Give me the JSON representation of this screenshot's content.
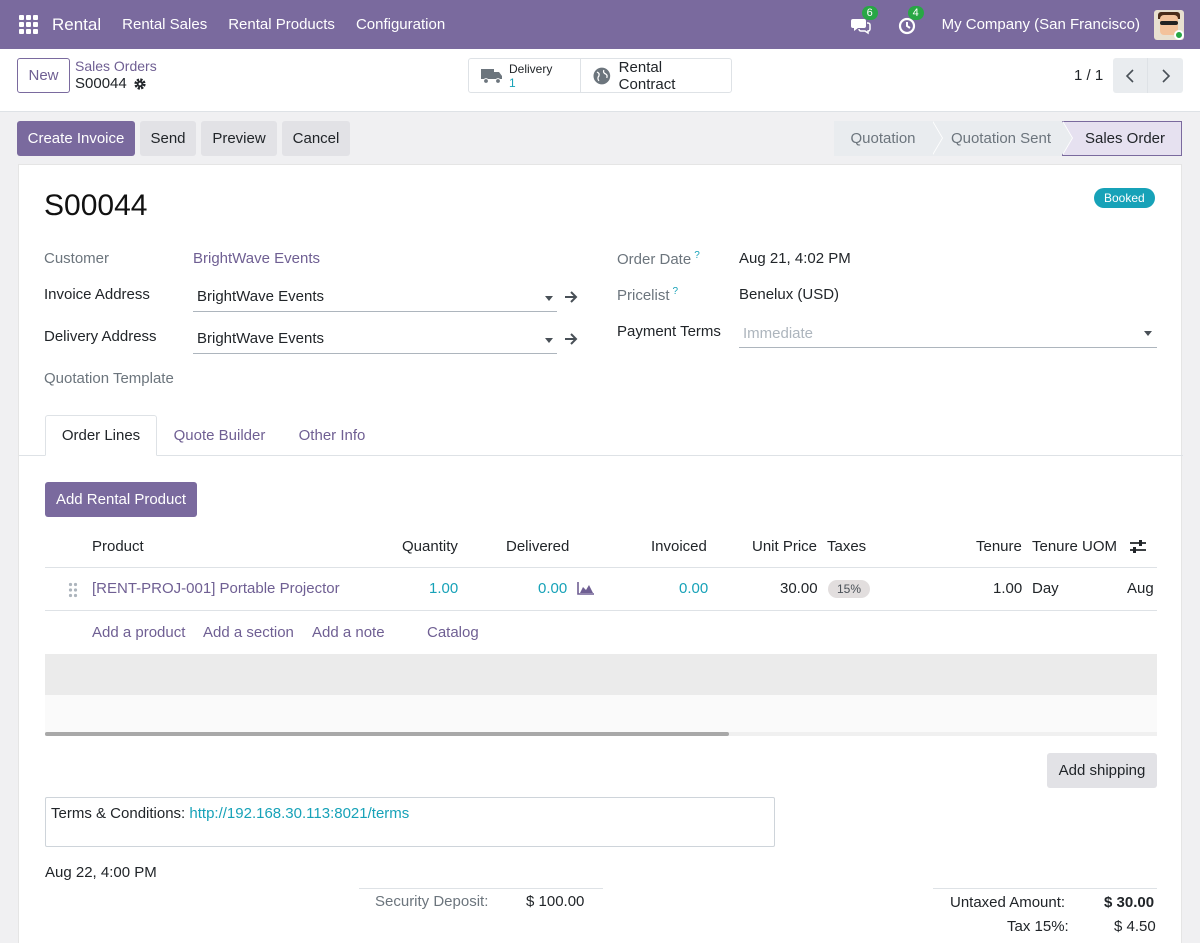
{
  "navbar": {
    "brand": "Rental",
    "menu": [
      "Rental Sales",
      "Rental Products",
      "Configuration"
    ],
    "messages_count": "6",
    "activities_count": "4",
    "company": "My Company (San Francisco)"
  },
  "control": {
    "new_label": "New",
    "breadcrumb_parent": "Sales Orders",
    "breadcrumb_current": "S00044",
    "delivery_label": "Delivery",
    "delivery_count": "1",
    "rental_contract_label": "Rental Contract",
    "pager": "1 / 1"
  },
  "statusbar": {
    "create_invoice": "Create Invoice",
    "send": "Send",
    "preview": "Preview",
    "cancel": "Cancel",
    "stages": [
      "Quotation",
      "Quotation Sent",
      "Sales Order"
    ],
    "active_stage": "Sales Order"
  },
  "form": {
    "title": "S00044",
    "status_badge": "Booked",
    "customer_label": "Customer",
    "customer_value": "BrightWave Events",
    "invoice_address_label": "Invoice Address",
    "invoice_address_value": "BrightWave Events",
    "delivery_address_label": "Delivery Address",
    "delivery_address_value": "BrightWave Events",
    "quotation_template_label": "Quotation Template",
    "order_date_label": "Order Date",
    "order_date_value": "Aug 21, 4:02 PM",
    "pricelist_label": "Pricelist",
    "pricelist_value": "Benelux (USD)",
    "payment_terms_label": "Payment Terms",
    "payment_terms_placeholder": "Immediate",
    "help_mark": "?"
  },
  "tabs": [
    "Order Lines",
    "Quote Builder",
    "Other Info"
  ],
  "order_lines": {
    "add_rental_product": "Add Rental Product",
    "headers": {
      "product": "Product",
      "quantity": "Quantity",
      "delivered": "Delivered",
      "invoiced": "Invoiced",
      "unit_price": "Unit Price",
      "taxes": "Taxes",
      "tenure": "Tenure",
      "tenure_uom": "Tenure UOM"
    },
    "rows": [
      {
        "product": "[RENT-PROJ-001] Portable Projector",
        "quantity": "1.00",
        "delivered": "0.00",
        "invoiced": "0.00",
        "unit_price": "30.00",
        "tax": "15%",
        "tenure": "1.00",
        "tenure_uom": "Day",
        "date": "Aug"
      }
    ],
    "add_product": "Add a product",
    "add_section": "Add a section",
    "add_note": "Add a note",
    "catalog": "Catalog"
  },
  "footer": {
    "add_shipping": "Add shipping",
    "terms_label": "Terms & Conditions:",
    "terms_url": "http://192.168.30.113:8021/terms",
    "return_date": "Aug 22, 4:00 PM",
    "security_deposit_label": "Security Deposit:",
    "security_deposit_value": "$ 100.00",
    "untaxed_label": "Untaxed Amount:",
    "untaxed_value": "$ 30.00",
    "tax_label": "Tax 15%:",
    "tax_value": "$ 4.50"
  },
  "colors": {
    "brand": "#7a6a9e",
    "link": "#6f5f93",
    "teal": "#17a2b8",
    "online": "#28a745"
  },
  "icons": [
    "apps-grid-icon",
    "chat-icon",
    "activity-clock-icon",
    "gear-icon",
    "truck-icon",
    "globe-icon",
    "chevron-left-icon",
    "chevron-right-icon",
    "arrow-right-icon",
    "chevron-down-icon",
    "drag-handle-icon",
    "forecast-chart-icon",
    "column-settings-icon"
  ]
}
